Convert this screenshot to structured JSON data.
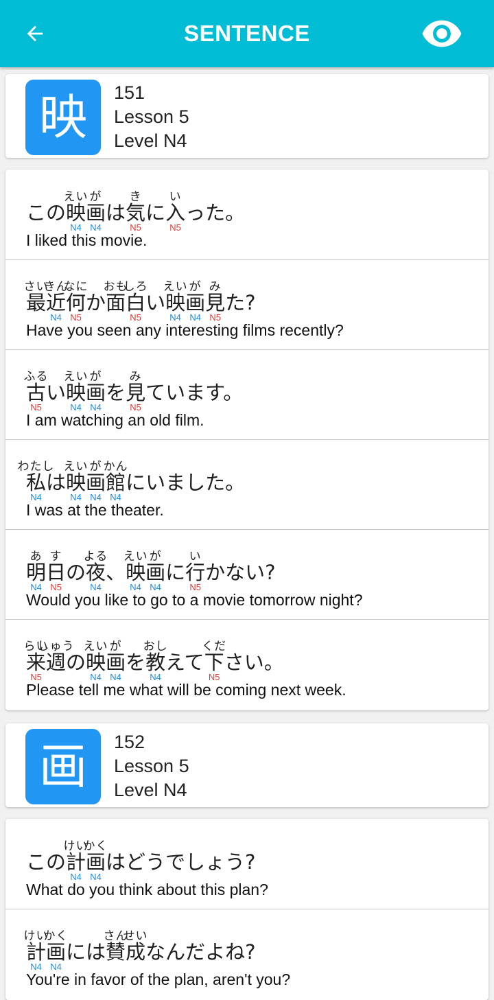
{
  "app": {
    "title": "SENTENCE",
    "back_icon": "arrow-left-icon",
    "toggle_icon": "eye-icon",
    "color": "#00bcd4"
  },
  "groups": [
    {
      "kanji": "映",
      "number": "151",
      "lesson": "Lesson 5",
      "level": "Level N4",
      "sentences": [
        {
          "segments": [
            {
              "t": "この"
            },
            {
              "t": "映",
              "r": "えい",
              "lv": "N4"
            },
            {
              "t": "画",
              "r": "が",
              "lv": "N4"
            },
            {
              "t": "は"
            },
            {
              "t": "気",
              "r": "き",
              "lv": "N5"
            },
            {
              "t": "に"
            },
            {
              "t": "入",
              "r": "い",
              "lv": "N5"
            },
            {
              "t": "った。"
            }
          ],
          "english": "I liked this movie."
        },
        {
          "segments": [
            {
              "t": "最",
              "r": "さい"
            },
            {
              "t": "近",
              "r": "きん",
              "lv": "N4"
            },
            {
              "t": "何",
              "r": "なに",
              "lv": "N5"
            },
            {
              "t": "か"
            },
            {
              "t": "面",
              "r": "おも"
            },
            {
              "t": "白",
              "r": "しろ",
              "lv": "N5"
            },
            {
              "t": "い"
            },
            {
              "t": "映",
              "r": "えい",
              "lv": "N4"
            },
            {
              "t": "画",
              "r": "が",
              "lv": "N4"
            },
            {
              "t": "見",
              "r": "み",
              "lv": "N5"
            },
            {
              "t": "た?"
            }
          ],
          "english": "Have you seen any interesting films recently?"
        },
        {
          "segments": [
            {
              "t": "古",
              "r": "ふる",
              "lv": "N5"
            },
            {
              "t": "い"
            },
            {
              "t": "映",
              "r": "えい",
              "lv": "N4"
            },
            {
              "t": "画",
              "r": "が",
              "lv": "N4"
            },
            {
              "t": "を"
            },
            {
              "t": "見",
              "r": "み",
              "lv": "N5"
            },
            {
              "t": "ています。"
            }
          ],
          "english": "I am watching an old film."
        },
        {
          "segments": [
            {
              "t": "私",
              "r": "わたし",
              "lv": "N4"
            },
            {
              "t": "は"
            },
            {
              "t": "映",
              "r": "えい",
              "lv": "N4"
            },
            {
              "t": "画",
              "r": "が",
              "lv": "N4"
            },
            {
              "t": "館",
              "r": "かん",
              "lv": "N4"
            },
            {
              "t": "にいました。"
            }
          ],
          "english": "I was at the theater."
        },
        {
          "segments": [
            {
              "t": "明",
              "r": "あ",
              "lv": "N4"
            },
            {
              "t": "日",
              "r": "す",
              "lv": "N5"
            },
            {
              "t": "の"
            },
            {
              "t": "夜",
              "r": "よる",
              "lv": "N4"
            },
            {
              "t": "、"
            },
            {
              "t": "映",
              "r": "えい",
              "lv": "N4"
            },
            {
              "t": "画",
              "r": "が",
              "lv": "N4"
            },
            {
              "t": "に"
            },
            {
              "t": "行",
              "r": "い",
              "lv": "N5"
            },
            {
              "t": "かない?"
            }
          ],
          "english": "Would you like to go to a movie tomorrow night?"
        },
        {
          "segments": [
            {
              "t": "来",
              "r": "らい",
              "lv": "N5"
            },
            {
              "t": "週",
              "r": "しゅう"
            },
            {
              "t": "の"
            },
            {
              "t": "映",
              "r": "えい",
              "lv": "N4"
            },
            {
              "t": "画",
              "r": "が",
              "lv": "N4"
            },
            {
              "t": "を"
            },
            {
              "t": "教",
              "r": "おし",
              "lv": "N4"
            },
            {
              "t": "えて"
            },
            {
              "t": "下",
              "r": "くだ",
              "lv": "N5"
            },
            {
              "t": "さい。"
            }
          ],
          "english": "Please tell me what will be coming next week."
        }
      ]
    },
    {
      "kanji": "画",
      "number": "152",
      "lesson": "Lesson 5",
      "level": "Level N4",
      "sentences": [
        {
          "segments": [
            {
              "t": "この"
            },
            {
              "t": "計",
              "r": "けい",
              "lv": "N4"
            },
            {
              "t": "画",
              "r": "かく",
              "lv": "N4"
            },
            {
              "t": "はどうでしょう?"
            }
          ],
          "english": "What do you think about this plan?"
        },
        {
          "segments": [
            {
              "t": "計",
              "r": "けい",
              "lv": "N4"
            },
            {
              "t": "画",
              "r": "かく",
              "lv": "N4"
            },
            {
              "t": "には"
            },
            {
              "t": "賛",
              "r": "さん"
            },
            {
              "t": "成",
              "r": "せい"
            },
            {
              "t": "なんだよね?"
            }
          ],
          "english": "You're in favor of the plan, aren't you?"
        }
      ]
    }
  ]
}
